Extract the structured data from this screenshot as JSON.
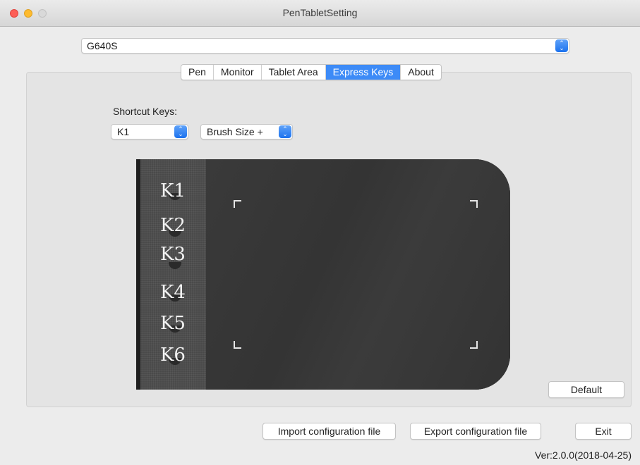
{
  "window": {
    "title": "PenTabletSetting"
  },
  "device": {
    "selected": "G640S"
  },
  "tabs": [
    {
      "label": "Pen"
    },
    {
      "label": "Monitor"
    },
    {
      "label": "Tablet Area"
    },
    {
      "label": "Express Keys",
      "active": true
    },
    {
      "label": "About"
    }
  ],
  "shortcut": {
    "label": "Shortcut Keys:",
    "key_selected": "K1",
    "action_selected": "Brush Size +"
  },
  "tablet": {
    "keys": [
      "K1",
      "K2",
      "K3",
      "K4",
      "K5",
      "K6"
    ]
  },
  "buttons": {
    "default": "Default",
    "import": "Import configuration file",
    "export": "Export configuration file",
    "exit": "Exit"
  },
  "version": "Ver:2.0.0(2018-04-25)",
  "colors": {
    "accent": "#3d8bf7",
    "close": "#fd5f57",
    "minimize": "#febb2e"
  }
}
